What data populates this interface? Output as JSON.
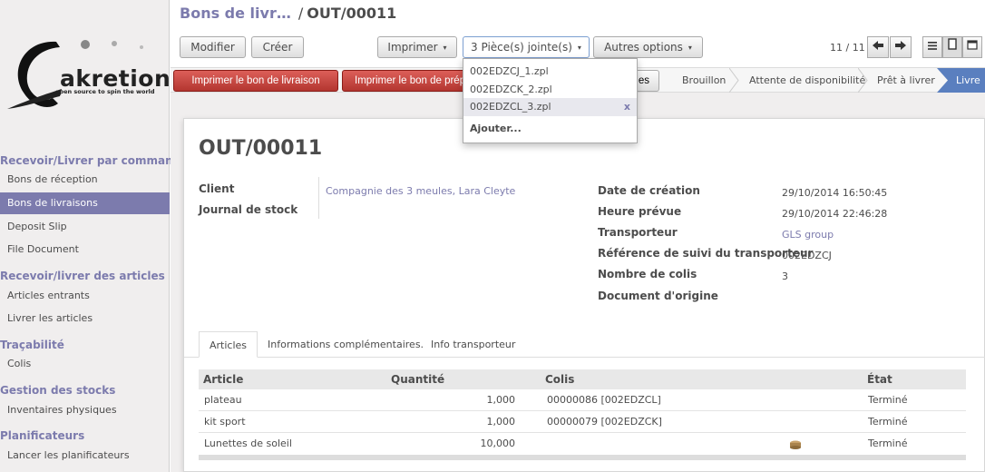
{
  "brand": {
    "logo_word": "akretion",
    "logo_tagline": "open source to spin the world"
  },
  "sidebar": {
    "sections": [
      {
        "title": "Recevoir/Livrer par commandes",
        "items": [
          "Bons de réception",
          "Bons de livraisons",
          "Deposit Slip",
          "File Document"
        ]
      },
      {
        "title": "Recevoir/livrer des articles",
        "items": [
          "Articles entrants",
          "Livrer les articles"
        ]
      },
      {
        "title": "Traçabilité",
        "items": [
          "Colis"
        ]
      },
      {
        "title": "Gestion des stocks",
        "items": [
          "Inventaires physiques"
        ]
      },
      {
        "title": "Planificateurs",
        "items": [
          "Lancer les planificateurs"
        ]
      }
    ],
    "active_item": "Bons de livraisons"
  },
  "breadcrumb": {
    "parent": "Bons de livr…",
    "separator": "/",
    "current": "OUT/00011"
  },
  "toolbar": {
    "edit_label": "Modifier",
    "create_label": "Créer",
    "print_label": "Imprimer",
    "attachments_label": "3 Pièce(s) jointe(s)",
    "more_label": "Autres options",
    "pager_text": "11 / 11"
  },
  "statusbar": {
    "print_delivery_label": "Imprimer le bon de livraison",
    "print_second_label": "Imprimer le bon de préparation",
    "third_label_tail": "es",
    "stages": [
      "Brouillon",
      "Attente de disponibilité",
      "Prêt à livrer",
      "Livré"
    ],
    "current_stage": "Livré",
    "current_stage_visible": "Livre"
  },
  "attachments_dropdown": {
    "files": [
      "002EDZCJ_1.zpl",
      "002EDZCK_2.zpl",
      "002EDZCL_3.zpl"
    ],
    "hovered_index": 2,
    "remove_glyph": "x",
    "add_label": "Ajouter..."
  },
  "record": {
    "title": "OUT/00011",
    "left_fields": [
      {
        "label": "Client",
        "value": "Compagnie des 3 meules, Lara Cleyte"
      },
      {
        "label": "Journal de stock",
        "value": ""
      }
    ],
    "right_fields": [
      {
        "label": "Date de création",
        "value": "29/10/2014 16:50:45"
      },
      {
        "label": "Heure prévue",
        "value": "29/10/2014 22:46:28"
      },
      {
        "label": "Transporteur",
        "value": "GLS group"
      },
      {
        "label": "Référence de suivi du transporteur",
        "value": "002EDZCJ"
      },
      {
        "label": "Nombre de colis",
        "value": "3"
      },
      {
        "label": "Document d'origine",
        "value": ""
      }
    ]
  },
  "tabs": [
    "Articles",
    "Informations complémentaires.",
    "Info transporteur"
  ],
  "active_tab": "Articles",
  "table": {
    "columns": [
      "Article",
      "Quantité",
      "Colis",
      "État"
    ],
    "rows": [
      {
        "article": "plateau",
        "quantity": "1,000",
        "colis": "00000086 [002EDZCL]",
        "state": "Terminé"
      },
      {
        "article": "kit sport",
        "quantity": "1,000",
        "colis": "00000079 [002EDZCK]",
        "state": "Terminé"
      },
      {
        "article": "Lunettes de soleil",
        "quantity": "10,000",
        "colis": "",
        "state": "Terminé"
      }
    ]
  },
  "colors": {
    "accent": "#7c7bad",
    "danger": "#c9433c",
    "stage_current": "#5a7fbf"
  }
}
